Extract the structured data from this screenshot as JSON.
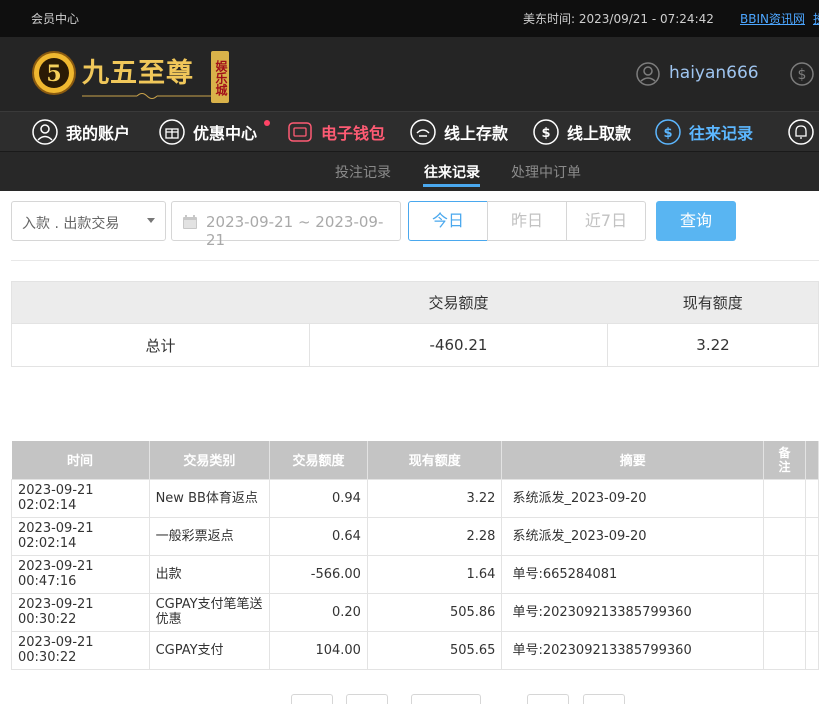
{
  "topbar": {
    "member_center": "会员中心",
    "time_label": "美东时间: 2023/09/21 - 07:24:42",
    "bbin_link": "BBIN资讯网",
    "more_link": "投"
  },
  "header": {
    "logo_text": "九五至尊",
    "logo_badge": "娱乐城",
    "username": "haiyan666"
  },
  "nav": {
    "items": [
      {
        "label": "我的账户",
        "icon": "user-circle-icon"
      },
      {
        "label": "优惠中心",
        "icon": "gift-icon"
      },
      {
        "label": "电子钱包",
        "icon": "wallet-icon"
      },
      {
        "label": "线上存款",
        "icon": "deposit-icon"
      },
      {
        "label": "线上取款",
        "icon": "withdraw-icon"
      },
      {
        "label": "往来记录",
        "icon": "record-icon"
      },
      {
        "label": "",
        "icon": "bell-icon"
      }
    ]
  },
  "subnav": {
    "tabs": [
      "投注记录",
      "往来记录",
      "处理中订单"
    ],
    "active": 1
  },
  "filter": {
    "type_value": "入款 . 出款交易",
    "date_range": "2023-09-21 ~ 2023-09-21",
    "today": "今日",
    "yesterday": "昨日",
    "last7": "近7日",
    "query": "查询"
  },
  "summary": {
    "col_amount": "交易额度",
    "col_balance": "现有额度",
    "total_label": "总计",
    "total_amount": "-460.21",
    "total_balance": "3.22"
  },
  "records": {
    "headers": [
      "时间",
      "交易类别",
      "交易额度",
      "现有额度",
      "摘要",
      "备注"
    ],
    "rows": [
      {
        "time": "2023-09-21 02:02:14",
        "type": "New BB体育返点",
        "amount": "0.94",
        "balance": "3.22",
        "summary": "系统派发_2023-09-20"
      },
      {
        "time": "2023-09-21 02:02:14",
        "type": "一般彩票返点",
        "amount": "0.64",
        "balance": "2.28",
        "summary": "系统派发_2023-09-20"
      },
      {
        "time": "2023-09-21 00:47:16",
        "type": "出款",
        "amount": "-566.00",
        "balance": "1.64",
        "summary": "单号:665284081"
      },
      {
        "time": "2023-09-21 00:30:22",
        "type": "CGPAY支付笔笔送优惠",
        "amount": "0.20",
        "balance": "505.86",
        "summary": "单号:202309213385799360"
      },
      {
        "time": "2023-09-21 00:30:22",
        "type": "CGPAY支付",
        "amount": "104.00",
        "balance": "505.65",
        "summary": "单号:202309213385799360"
      }
    ]
  },
  "colors": {
    "accent_blue": "#59b5f2",
    "nav_red": "#ff5b74",
    "nav_blue": "#5cb7ff",
    "logo_gold": "#f0c75a"
  }
}
